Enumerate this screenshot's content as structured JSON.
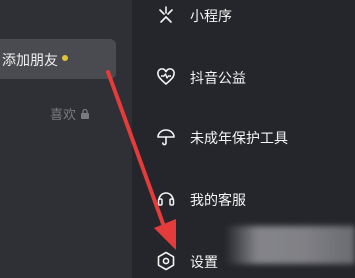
{
  "left_panel": {
    "add_friend_label": "添加朋友",
    "likes_label": "喜欢"
  },
  "menu": {
    "items": [
      {
        "label": "小程序",
        "icon": "mini-program-icon"
      },
      {
        "label": "抖音公益",
        "icon": "charity-icon"
      },
      {
        "label": "未成年保护工具",
        "icon": "umbrella-icon"
      },
      {
        "label": "我的客服",
        "icon": "headset-icon"
      },
      {
        "label": "设置",
        "icon": "settings-hexagon-icon"
      }
    ]
  },
  "colors": {
    "accent_dot": "#e2c23a",
    "arrow": "#e63b3b"
  }
}
